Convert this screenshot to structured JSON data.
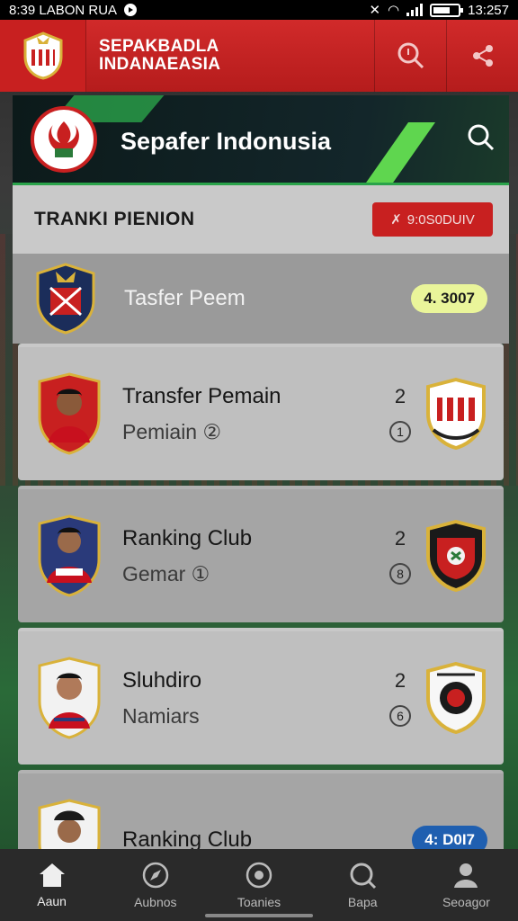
{
  "status_bar": {
    "time_left": "8:39 LABON RUA",
    "time_right": "13:257"
  },
  "header": {
    "title_line1": "SEPAKBADLA",
    "title_line2": "INDANAEASIA"
  },
  "banner": {
    "title": "Sepafer Indonusia"
  },
  "section": {
    "title": "TRANKI PIENION",
    "badge_text": "9:0S0DUIV"
  },
  "featured": {
    "name": "Tasfer Peem",
    "badge": "4. 3007"
  },
  "cards": [
    {
      "title": "Transfer Pemain",
      "subtitle": "Pemiain ②",
      "number": "2",
      "circle": "1"
    },
    {
      "title": "Ranking Club",
      "subtitle": "Gemar ①",
      "number": "2",
      "circle": "8"
    },
    {
      "title": "Sluhdiro",
      "subtitle": "Namiars",
      "number": "2",
      "circle": "6"
    },
    {
      "title": "Ranking Club",
      "badge": "4: D0I7"
    }
  ],
  "nav": [
    {
      "label": "Aaun",
      "icon": "home-icon"
    },
    {
      "label": "Aubnos",
      "icon": "compass-icon"
    },
    {
      "label": "Toanies",
      "icon": "ball-icon"
    },
    {
      "label": "Bapa",
      "icon": "search-icon"
    },
    {
      "label": "Seoagor",
      "icon": "user-icon"
    }
  ],
  "colors": {
    "brand_red": "#c82020",
    "accent_green": "#2aa34a",
    "nav_bg": "#2a2a2a"
  }
}
